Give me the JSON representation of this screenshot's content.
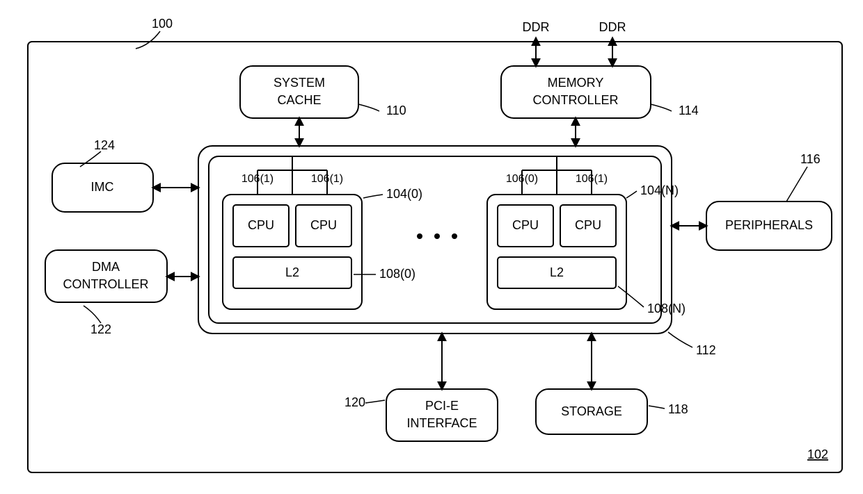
{
  "refs": {
    "system": "100",
    "chip": "102",
    "cluster0": "104(0)",
    "clusterN": "104(N)",
    "cpu00": "106(1)",
    "cpu01": "106(1)",
    "cpuN0": "106(0)",
    "cpuN1": "106(1)",
    "l2_0": "108(0)",
    "l2_N": "108(N)",
    "syscache": "110",
    "bus": "112",
    "memctrl": "114",
    "periph": "116",
    "storage": "118",
    "pcie": "120",
    "dma": "122",
    "imc": "124"
  },
  "labels": {
    "syscache_l1": "SYSTEM",
    "syscache_l2": "CACHE",
    "memctrl_l1": "MEMORY",
    "memctrl_l2": "CONTROLLER",
    "ddr": "DDR",
    "imc": "IMC",
    "dma_l1": "DMA",
    "dma_l2": "CONTROLLER",
    "cpu": "CPU",
    "l2": "L2",
    "periph": "PERIPHERALS",
    "storage": "STORAGE",
    "pcie_l1": "PCI-E",
    "pcie_l2": "INTERFACE"
  }
}
